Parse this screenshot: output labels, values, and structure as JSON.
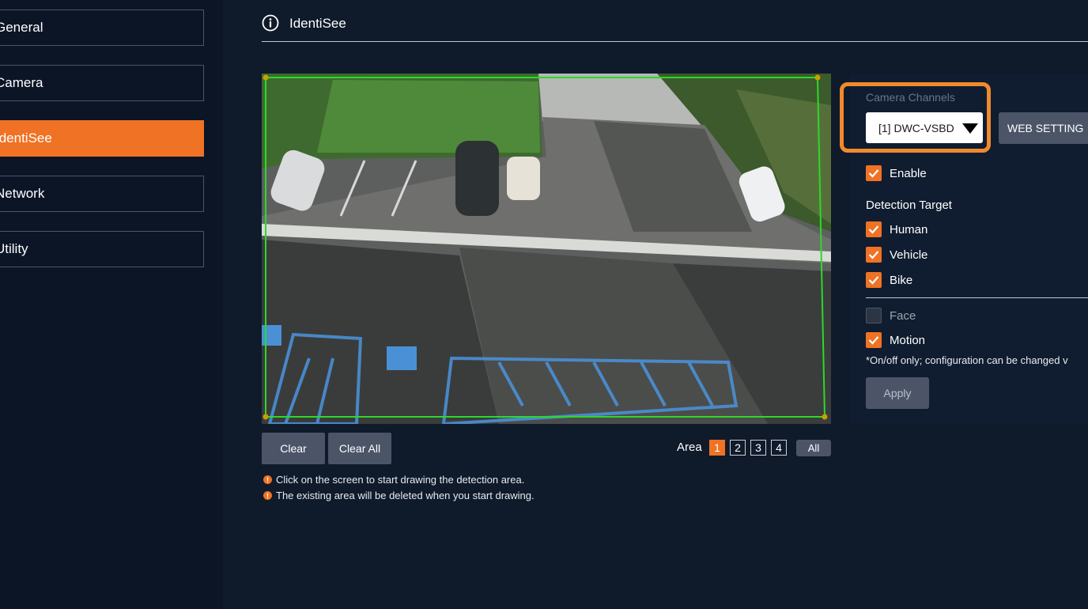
{
  "sidebar": {
    "items": [
      {
        "label": "General"
      },
      {
        "label": "Camera"
      },
      {
        "label": "IdentiSee"
      },
      {
        "label": "Network"
      },
      {
        "label": "Utility"
      }
    ],
    "active_index": 2
  },
  "header": {
    "title": "IdentiSee",
    "icon": "info-icon"
  },
  "video": {
    "description_icon": "camera-feed"
  },
  "controls": {
    "clear_label": "Clear",
    "clear_all_label": "Clear All",
    "area_label": "Area",
    "areas": [
      "1",
      "2",
      "3",
      "4"
    ],
    "active_area": "1",
    "all_label": "All"
  },
  "hints": [
    "Click on the screen to start drawing the detection area.",
    "The existing area will be deleted when you start drawing."
  ],
  "panel": {
    "camera_channels_label": "Camera Channels",
    "selected_channel": "[1] DWC-VSBD",
    "web_setting_label": "WEB SETTING",
    "enable_label": "Enable",
    "enable_checked": true,
    "detection_target_label": "Detection Target",
    "targets": [
      {
        "label": "Human",
        "checked": true
      },
      {
        "label": "Vehicle",
        "checked": true
      },
      {
        "label": "Bike",
        "checked": true
      }
    ],
    "face_label": "Face",
    "face_checked": false,
    "motion_label": "Motion",
    "motion_checked": true,
    "note": "*On/off only; configuration can be changed v",
    "apply_label": "Apply"
  },
  "colors": {
    "accent": "#f07225",
    "highlight": "#f18a2c",
    "zone": "#2bd92b"
  }
}
